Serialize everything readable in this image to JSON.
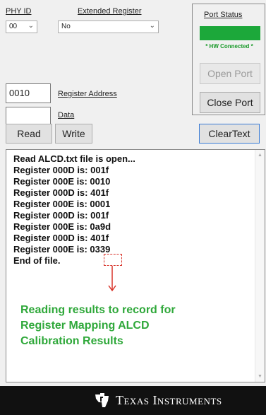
{
  "phy_id": {
    "label": "PHY ID",
    "value": "00"
  },
  "extended_register": {
    "label": "Extended Register",
    "value": "No"
  },
  "port_status": {
    "label": "Port Status",
    "indicator_color": "#1ca83a",
    "status_text": "* HW Connected *",
    "open_port_label": "Open Port",
    "close_port_label": "Close Port"
  },
  "register": {
    "address_value": "0010",
    "address_label": "Register Address",
    "data_value": "",
    "data_label": "Data"
  },
  "buttons": {
    "read": "Read",
    "write": "Write",
    "clear": "ClearText"
  },
  "log_lines": [
    "Read ALCD.txt file is open...",
    "Register 000D is: 001f",
    "Register 000E is: 0010",
    "Register 000D is: 401f",
    "Register 000E is: 0001",
    "Register 000D is: 001f",
    "Register 000E is: 0a9d",
    "Register 000D is: 401f",
    "Register 000E is: 0339",
    "End of file."
  ],
  "annotation": {
    "color": "#2fa83a",
    "highlight_color": "#d9342b",
    "lines": [
      "Reading results to record for",
      "Register Mapping ALCD",
      "Calibration Results"
    ]
  },
  "footer": {
    "brand": "Texas Instruments",
    "logo": "ti-logo-icon"
  }
}
